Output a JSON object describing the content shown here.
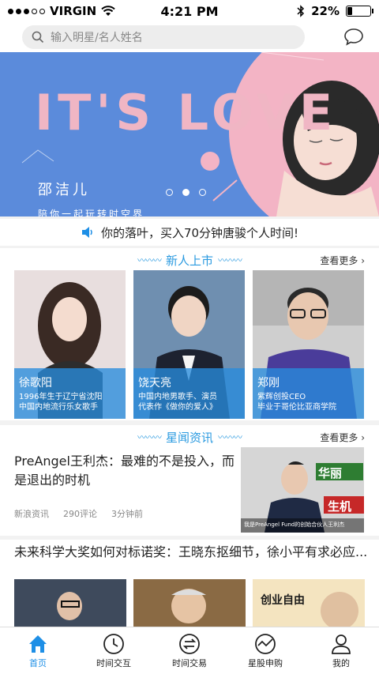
{
  "status": {
    "carrier": "VIRGIN",
    "time": "4:21 PM",
    "battery": "22%",
    "battery_level": 0.22
  },
  "search": {
    "placeholder": "输入明星/名人姓名"
  },
  "banner": {
    "title": "IT'S LOVE",
    "name": "邵洁儿",
    "subtitle": "陪你一起玩转时空界",
    "active_slide": 2,
    "slide_count": 3
  },
  "notice": {
    "text": "你的落叶，买入70分钟唐骏个人时间!"
  },
  "new_section": {
    "title": "新人上市",
    "more": "查看更多",
    "cards": [
      {
        "name": "徐歌阳",
        "desc1": "1996年生于辽宁省沈阳",
        "desc2": "中国内地流行乐女歌手"
      },
      {
        "name": "饶天亮",
        "desc1": "中国内地男歌手、演员",
        "desc2": "代表作《做你的爱人》"
      },
      {
        "name": "郑刚",
        "desc1": "紫辉创投CEO",
        "desc2": "毕业于哥伦比亚商学院"
      }
    ]
  },
  "news_section": {
    "title": "星闻资讯",
    "more": "查看更多",
    "headline": "PreAngel王利杰：最难的不是投入，而是退出的时机",
    "source": "新浪资讯",
    "comments": "290评论",
    "time": "3分钟前",
    "thumb_text1": "华丽",
    "thumb_text2": "生机",
    "thumb_caption": "我是PreAngel Fund的创始合伙人王利杰"
  },
  "news2": {
    "headline": "未来科学大奖如何对标诺奖：王晓东抠细节，徐小平有求必应...",
    "img_text": "创业自由"
  },
  "tabbar": [
    {
      "label": "首页",
      "icon": "home-icon"
    },
    {
      "label": "时间交互",
      "icon": "clock-icon"
    },
    {
      "label": "时间交易",
      "icon": "exchange-icon"
    },
    {
      "label": "星股申购",
      "icon": "chart-icon"
    },
    {
      "label": "我的",
      "icon": "person-icon"
    }
  ],
  "colors": {
    "accent": "#1e8fe6",
    "banner_bg": "#5b8bdb",
    "banner_pink": "#f0b6c4"
  }
}
